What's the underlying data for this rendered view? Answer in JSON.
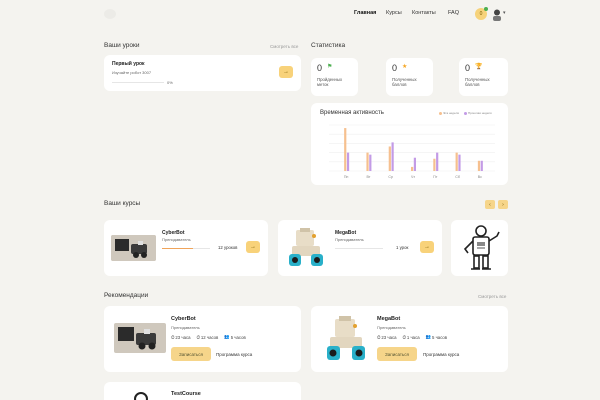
{
  "nav": {
    "items": [
      "Главная",
      "Курсы",
      "Контакты",
      "FAQ"
    ],
    "notif_count": "0"
  },
  "lessons": {
    "title": "Ваши уроки",
    "see_all": "Смотреть все",
    "card_title": "Первый урок",
    "card_sub": "Изучайте робот 3007",
    "progress": "0%",
    "progress_value": 0
  },
  "stats": {
    "title": "Статистика",
    "items": [
      {
        "value": "0",
        "label1": "Пройденных",
        "label2": "меток",
        "icon": "flag-icon",
        "color": "#4caf50"
      },
      {
        "value": "0",
        "label1": "Полученных",
        "label2": "баллов",
        "icon": "star-icon",
        "color": "#f5a623"
      },
      {
        "value": "0",
        "label1": "Полученных",
        "label2": "баллов",
        "icon": "trophy-icon",
        "color": "#e6b800"
      }
    ]
  },
  "activity": {
    "title": "Временная активность",
    "legend": [
      "Эта неделя",
      "Прошлая неделя"
    ]
  },
  "chart_data": {
    "type": "bar",
    "categories": [
      "Пн",
      "Вт",
      "Ср",
      "Чт",
      "Пт",
      "Сб",
      "Вс"
    ],
    "series": [
      {
        "name": "Эта неделя",
        "values": [
          42,
          18,
          24,
          4,
          12,
          18,
          10
        ],
        "color": "#f6c08f"
      },
      {
        "name": "Прошлая неделя",
        "values": [
          18,
          16,
          28,
          13,
          18,
          16,
          10
        ],
        "color": "#c39be6"
      }
    ],
    "ylim": [
      0,
      45
    ]
  },
  "courses": {
    "title": "Ваши курсы",
    "items": [
      {
        "name": "CyberBot",
        "teacher": "Преподаватель",
        "lessons": "12 уроков",
        "progress_value": 0.65
      },
      {
        "name": "MegaBot",
        "teacher": "Преподаватель",
        "lessons": "1 урок",
        "progress_value": 0.0
      }
    ]
  },
  "recs": {
    "title": "Рекомендации",
    "see_all": "Смотреть все",
    "items": [
      {
        "name": "CyberBot",
        "teacher": "Преподаватель",
        "m1": "23 часа",
        "m2": "12 часов",
        "m3": "5 часов",
        "enroll": "Записаться",
        "program": "Программа курса"
      },
      {
        "name": "MegaBot",
        "teacher": "Преподаватель",
        "m1": "23 часа",
        "m2": "1 часа",
        "m3": "5 часов",
        "enroll": "Записаться",
        "program": "Программа курса"
      },
      {
        "name": "TestCourse"
      }
    ]
  }
}
